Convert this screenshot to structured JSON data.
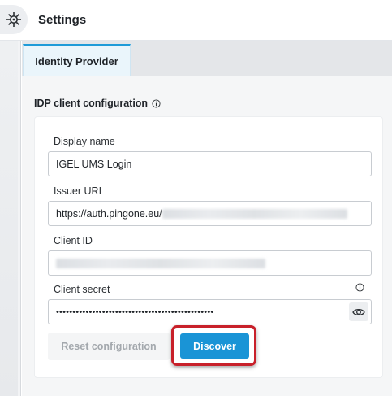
{
  "header": {
    "title": "Settings",
    "icon": "gear-network-icon"
  },
  "tabs": [
    {
      "label": "Identity Provider",
      "active": true
    }
  ],
  "section": {
    "title": "IDP client configuration",
    "info_icon": "info-icon"
  },
  "form": {
    "display_name": {
      "label": "Display name",
      "value": "IGEL UMS Login"
    },
    "issuer_uri": {
      "label": "Issuer URI",
      "value": "https://auth.pingone.eu/"
    },
    "client_id": {
      "label": "Client ID",
      "value": ""
    },
    "client_secret": {
      "label": "Client secret",
      "value": "••••••••••••••••••••••••••••••••••••••••••••••••",
      "toggle_icon": "eye-icon"
    }
  },
  "buttons": {
    "reset": "Reset configuration",
    "discover": "Discover"
  },
  "colors": {
    "accent": "#1a94d6",
    "highlight": "#c8202a",
    "tab_border": "#1f9bd8"
  }
}
